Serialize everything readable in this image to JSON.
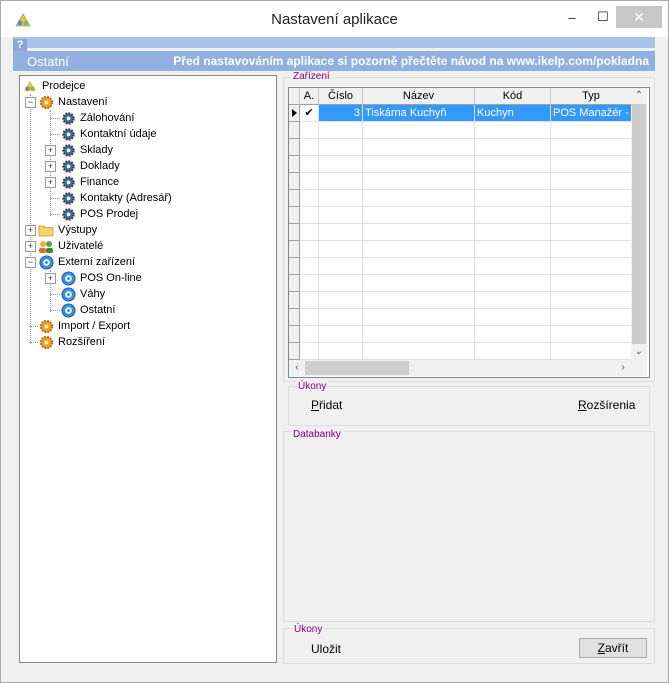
{
  "window": {
    "title": "Nastavení aplikace",
    "minimize_glyph": "–",
    "maximize_glyph": "☐",
    "close_glyph": "✕"
  },
  "help_glyph": "?",
  "header": {
    "section": "Ostatní",
    "note": "Před nastavováním aplikace si pozorně přečtěte návod na www.ikelp.com/pokladna"
  },
  "tree": {
    "root": "Prodejce",
    "nastaveni": "Nastavení",
    "zalohovani": "Zálohování",
    "kontaktni_udaje": "Kontaktní údaje",
    "sklady": "Sklady",
    "doklady": "Doklady",
    "finance": "Finance",
    "kontakty": "Kontakty (Adresář)",
    "pos_prodej": "POS Prodej",
    "vystupy": "Výstupy",
    "uzivatele": "Uživatelé",
    "externi": "Externí zařízení",
    "pos_online": "POS On-line",
    "vahy": "Váhy",
    "ostatni": "Ostatní",
    "import_export": "Import / Export",
    "rozsireni": "Rozšíření"
  },
  "devices": {
    "group_label": "Zařízení",
    "columns": [
      "A.",
      "Číslo",
      "Název",
      "Kód",
      "Typ"
    ],
    "rows": [
      {
        "active": "✔",
        "cislo": "3",
        "nazev": "Tiskárna Kuchyň",
        "kod": "Kuchyn",
        "typ": "POS Manažér -"
      }
    ]
  },
  "actions1": {
    "label": "Úkony",
    "add_prefix": "",
    "add_key": "P",
    "add_rest": "řidat",
    "ext_key": "R",
    "ext_rest": "ozšírenia"
  },
  "databanky": {
    "label": "Databanky"
  },
  "actions2": {
    "label": "Úkony",
    "save": "Uložit",
    "close_key": "Z",
    "close_rest": "avřít"
  },
  "colors": {
    "header_bar": "#91b0e0",
    "selection": "#3399ff",
    "group_label": "#800080"
  }
}
